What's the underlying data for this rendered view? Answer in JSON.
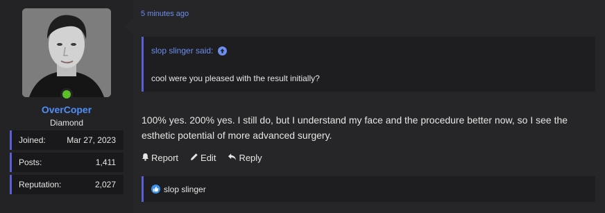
{
  "user": {
    "username": "OverCoper",
    "title": "Diamond",
    "avatar_icon": "user-avatar-photo",
    "online_color": "#5cbf2a",
    "stats": [
      {
        "label": "Joined:",
        "value": "Mar 27, 2023"
      },
      {
        "label": "Posts:",
        "value": "1,411"
      },
      {
        "label": "Reputation:",
        "value": "2,027"
      }
    ]
  },
  "post": {
    "time": "5 minutes ago",
    "quote": {
      "author": "slop slinger said:",
      "text": "cool were you pleased with the result initially?"
    },
    "message": "100% yes. 200% yes. I still do, but I understand my face and the procedure better now, so I see the esthetic potential of more advanced surgery.",
    "actions": {
      "report": "Report",
      "edit": "Edit",
      "reply": "Reply"
    },
    "reactions": {
      "users": "slop slinger"
    }
  },
  "colors": {
    "accent": "#5b5fd6",
    "link": "#6b8ff0",
    "username": "#4f8ff7",
    "background": "#262628"
  }
}
